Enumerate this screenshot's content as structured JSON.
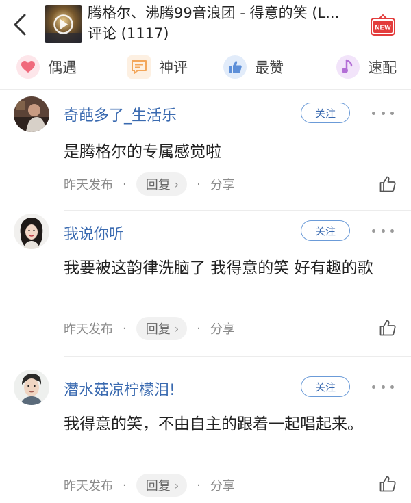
{
  "header": {
    "song_title": "腾格尔、沸腾99音浪团 - 得意的笑 (L...",
    "comment_count": "评论 (1117)",
    "new_badge": "NEW"
  },
  "tabs": [
    {
      "label": "偶遇",
      "icon": "heart-chat-icon",
      "color": "#f06a7c"
    },
    {
      "label": "神评",
      "icon": "message-icon",
      "color": "#f3a65a"
    },
    {
      "label": "最赞",
      "icon": "thumb-icon",
      "color": "#5d8fd8"
    },
    {
      "label": "速配",
      "icon": "music-note-icon",
      "color": "#b36ed6"
    }
  ],
  "comments": [
    {
      "username": "奇葩多了_生活乐",
      "follow": "关注",
      "text": "是腾格尔的专属感觉啦",
      "time": "昨天发布",
      "reply": "回复",
      "share": "分享"
    },
    {
      "username": "我说你听",
      "follow": "关注",
      "text": "我要被这韵律洗脑了 我得意的笑 好有趣的歌",
      "time": "昨天发布",
      "reply": "回复",
      "share": "分享"
    },
    {
      "username": "潜水菇凉柠檬泪!",
      "follow": "关注",
      "text": "我得意的笑，不由自主的跟着一起唱起来。",
      "time": "昨天发布",
      "reply": "回复",
      "share": "分享"
    }
  ]
}
